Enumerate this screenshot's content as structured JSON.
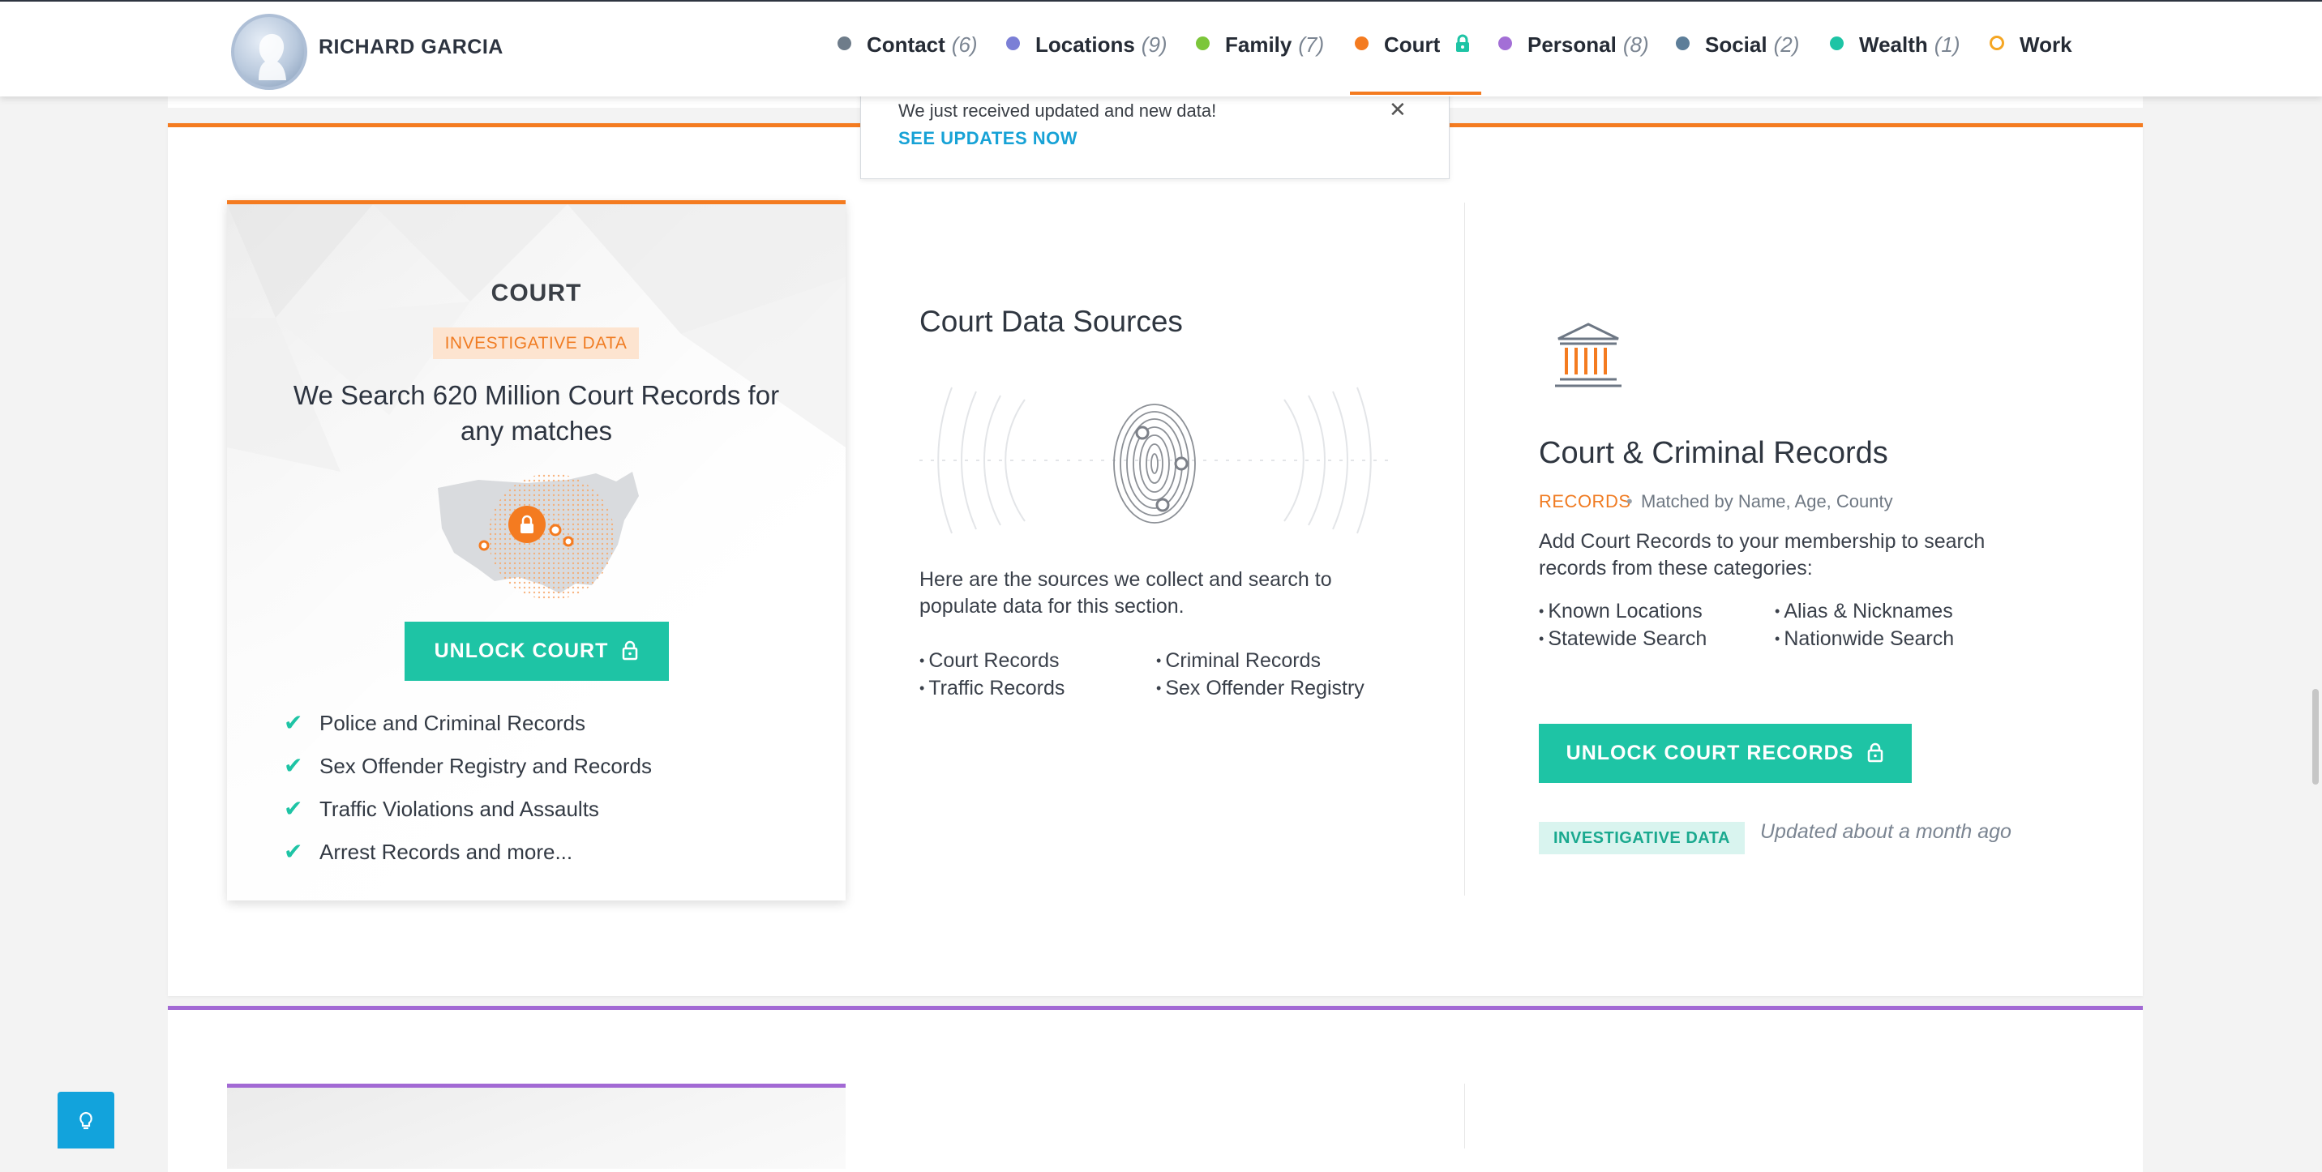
{
  "profile": {
    "name": "RICHARD GARCIA"
  },
  "nav": {
    "items": [
      {
        "label": "Contact",
        "count": "(6)",
        "color": "#6e7c8a"
      },
      {
        "label": "Locations",
        "count": "(9)",
        "color": "#7b7fd6"
      },
      {
        "label": "Family",
        "count": "(7)",
        "color": "#7cc63a"
      },
      {
        "label": "Court",
        "count": "",
        "color": "#f47b20",
        "icon": "lock-icon",
        "active": true
      },
      {
        "label": "Personal",
        "count": "(8)",
        "color": "#a36fd6"
      },
      {
        "label": "Social",
        "count": "(2)",
        "color": "#5d7e99"
      },
      {
        "label": "Wealth",
        "count": "(1)",
        "color": "#1ec4a5"
      },
      {
        "label": "Work",
        "count": "",
        "color": "#f5a623",
        "hollow": true
      }
    ]
  },
  "notification": {
    "message": "We just received updated and new data!",
    "link": "SEE UPDATES NOW",
    "close_icon": "close-icon"
  },
  "court_card": {
    "title": "COURT",
    "badge": "INVESTIGATIVE DATA",
    "headline": "We Search 620 Million Court Records for any matches",
    "button": "UNLOCK COURT",
    "features": [
      "Police and Criminal Records",
      "Sex Offender Registry and Records",
      "Traffic Violations and Assaults",
      "Arrest Records and more..."
    ]
  },
  "sources": {
    "title": "Court Data Sources",
    "description": "Here are the sources we collect and search to populate data for this section.",
    "items": [
      "Court Records",
      "Criminal Records",
      "Traffic Records",
      "Sex Offender Registry"
    ]
  },
  "records": {
    "title": "Court & Criminal Records",
    "tag": "RECORDS",
    "separator": "•",
    "match": "Matched by Name, Age, County",
    "description": "Add Court Records to your membership to search records from these categories:",
    "categories": [
      "Known Locations",
      "Alias & Nicknames",
      "Statewide Search",
      "Nationwide Search"
    ],
    "button": "UNLOCK COURT RECORDS",
    "badge": "INVESTIGATIVE DATA",
    "updated": "Updated about a month ago"
  },
  "colors": {
    "accent_orange": "#f47b20",
    "accent_teal": "#1ec4a5",
    "accent_purple": "#a269d4",
    "link_blue": "#17a2d6"
  }
}
